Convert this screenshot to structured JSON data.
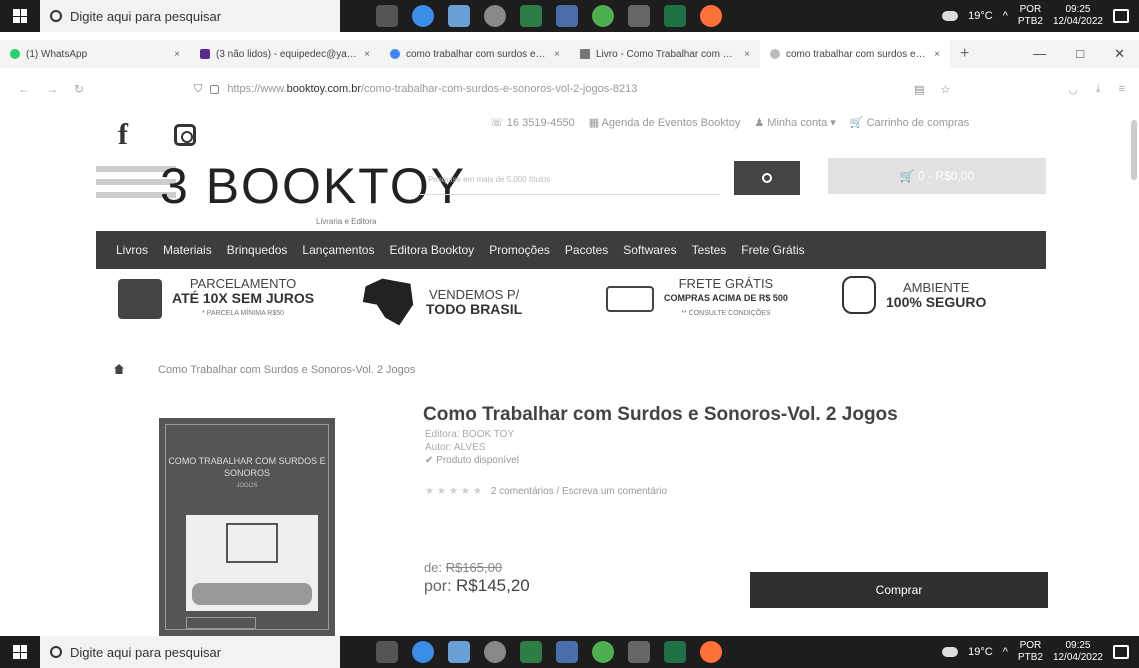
{
  "taskbar": {
    "search_placeholder": "Digite aqui para pesquisar",
    "weather": "19°C",
    "lang": "POR",
    "lang_sub": "PTB2",
    "time": "09:25",
    "date": "12/04/2022"
  },
  "tabs": [
    {
      "label": "(1) WhatsApp",
      "close": "×"
    },
    {
      "label": "(3 não lidos) - equipedec@yah...",
      "close": "×"
    },
    {
      "label": "como trabalhar com surdos e s...",
      "close": "×"
    },
    {
      "label": "Livro - Como Trabalhar com Su...",
      "close": "×"
    },
    {
      "label": "como trabalhar com surdos e s...",
      "close": "×"
    }
  ],
  "tab_new": "+",
  "window_controls": {
    "minimize": "—",
    "maximize": "□",
    "close": "✕"
  },
  "address": {
    "prefix": "https://www.",
    "domain": "booktoy.com.br",
    "path": "/como-trabalhar-com-surdos-e-sonoros-vol-2-jogos-8213"
  },
  "header": {
    "phone": "☏ 16 3519-4550",
    "agenda": "▦ Agenda de Eventos Booktoy",
    "account": "♟ Minha conta ▾",
    "cart_link": "🛒 Carrinho de compras",
    "logo": "3 BOOKTOY",
    "logo_sub": "Livraria e Editora",
    "search_placeholder": "Pesquise em mais de 5.000 títulos",
    "cart_button": "🛒 0 - R$0,00"
  },
  "nav": [
    "Livros",
    "Materiais",
    "Brinquedos",
    "Lançamentos",
    "Editora Booktoy",
    "Promoções",
    "Pacotes",
    "Softwares",
    "Testes",
    "Frete Grátis"
  ],
  "info": {
    "parcel": {
      "l1": "PARCELAMENTO",
      "l2": "ATÉ 10X SEM JUROS",
      "l3": "* PARCELA MÍNIMA R$50"
    },
    "brasil": {
      "l1": "VENDEMOS P/",
      "l2": "TODO BRASIL"
    },
    "frete": {
      "l1": "FRETE GRÁTIS",
      "l2": "COMPRAS ACIMA DE R$ 500",
      "l3": "** CONSULTE CONDIÇÕES"
    },
    "seguro": {
      "l1": "AMBIENTE",
      "l2": "100% SEGURO"
    }
  },
  "breadcrumb": "Como Trabalhar com Surdos e Sonoros-Vol. 2 Jogos",
  "book_cover": {
    "title": "COMO TRABALHAR COM SURDOS E SONOROS",
    "subtitle": "JOGOS"
  },
  "product": {
    "title": "Como Trabalhar com Surdos e Sonoros-Vol. 2 Jogos",
    "editora": "Editora: BOOK TOY",
    "autor": "Autor: ALVES",
    "availability": "✔ Produto disponível",
    "stars": "★★★★★",
    "reviews": "2 comentários / Escreva um comentário",
    "old_label": "de:",
    "old_price": "R$165,00",
    "new_label": "por:",
    "new_price": "R$145,20",
    "buy": "Comprar"
  }
}
